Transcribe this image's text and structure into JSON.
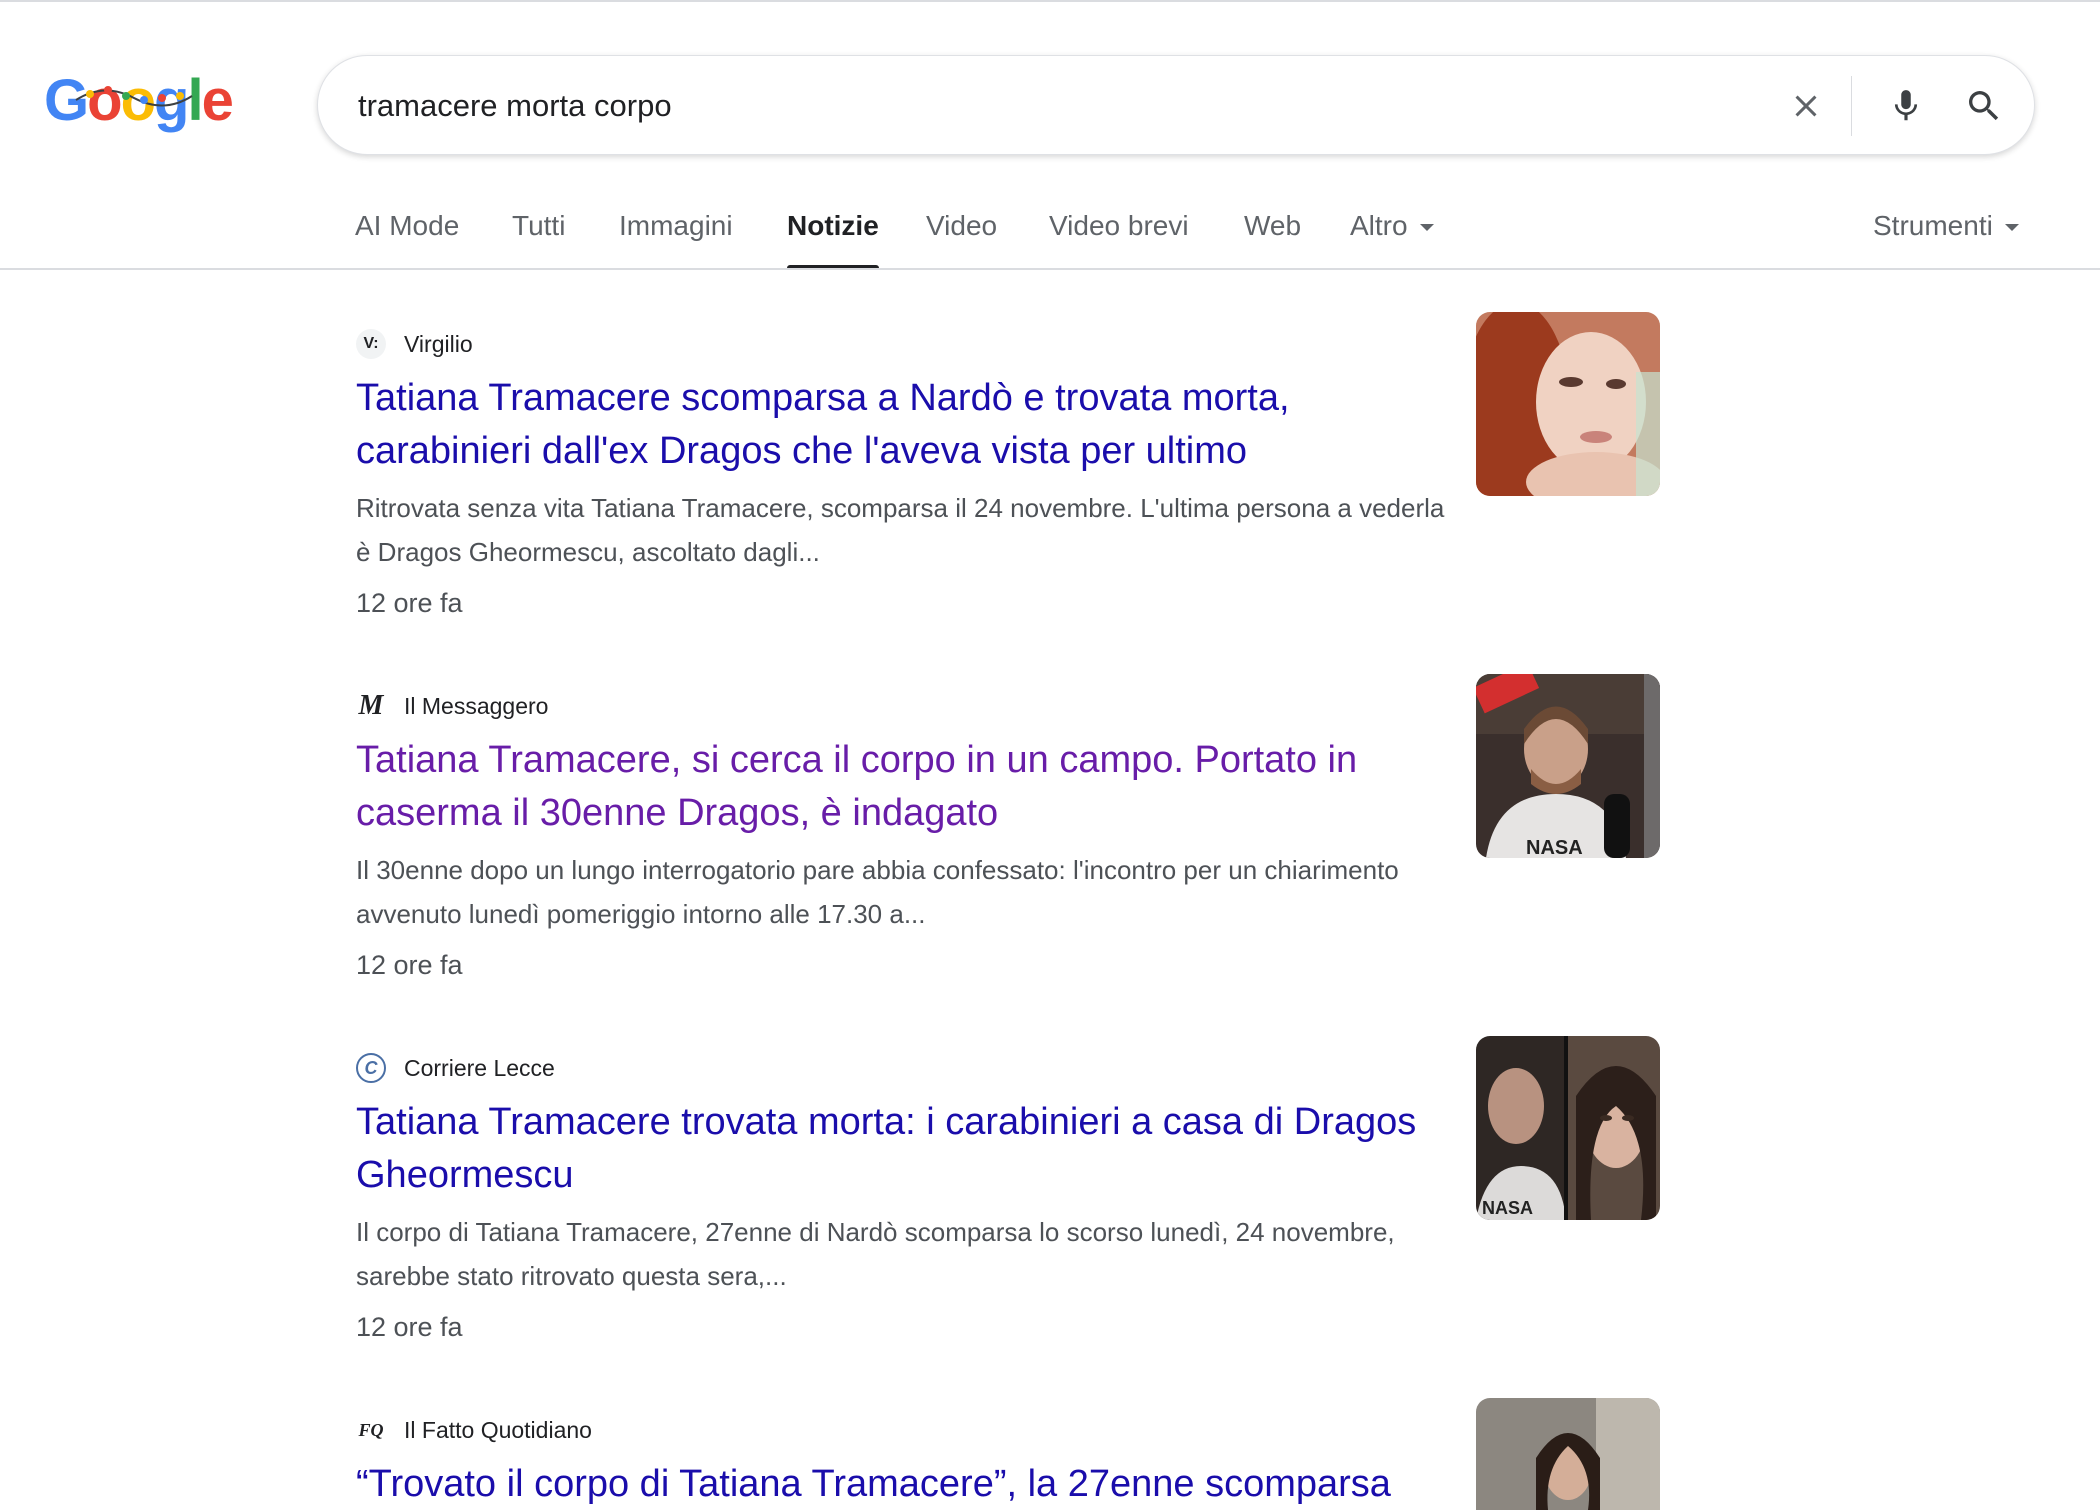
{
  "logo": {
    "letters": [
      "G",
      "o",
      "o",
      "g",
      "l",
      "e"
    ]
  },
  "search": {
    "query": "tramacere morta corpo"
  },
  "search_icons": {
    "clear": "close-icon",
    "voice": "mic-icon",
    "submit": "search-icon"
  },
  "tabs": [
    {
      "label": "AI Mode"
    },
    {
      "label": "Tutti"
    },
    {
      "label": "Immagini"
    },
    {
      "label": "Notizie"
    },
    {
      "label": "Video"
    },
    {
      "label": "Video brevi"
    },
    {
      "label": "Web"
    },
    {
      "label": "Altro"
    }
  ],
  "tools": {
    "label": "Strumenti"
  },
  "active_tab": "Notizie",
  "colors": {
    "link": "#1a0dab",
    "visited": "#681da8",
    "snippet": "#4d5156"
  },
  "results": [
    {
      "source": "Virgilio",
      "favicon_text": "V:",
      "title": "Tatiana Tramacere scomparsa a Nardò e trovata morta, carabinieri dall'ex Dragos che l'aveva vista per ultimo",
      "snippet": "Ritrovata senza vita Tatiana Tramacere, scomparsa il 24 novembre. L'ultima persona a vederla è Dragos Gheormescu, ascoltato dagli...",
      "time": "12 ore fa"
    },
    {
      "source": "Il Messaggero",
      "favicon_text": "M",
      "title": "Tatiana Tramacere, si cerca il corpo in un campo. Portato in caserma il 30enne Dragos, è indagato",
      "snippet": "Il 30enne dopo un lungo interrogatorio pare abbia confessato: l'incontro per un chiarimento avvenuto lunedì pomeriggio intorno alle 17.30 a...",
      "time": "12 ore fa"
    },
    {
      "source": "Corriere Lecce",
      "favicon_text": "C",
      "title": "Tatiana Tramacere trovata morta: i carabinieri a casa di Dragos Gheormescu",
      "snippet": "Il corpo di Tatiana Tramacere, 27enne di Nardò scomparsa lo scorso lunedì, 24 novembre, sarebbe stato ritrovato questa sera,...",
      "time": "12 ore fa"
    },
    {
      "source": "Il Fatto Quotidiano",
      "favicon_text": "FQ",
      "title": "“Trovato il corpo di Tatiana Tramacere”, la 27enne scomparsa",
      "snippet": "",
      "time": ""
    }
  ]
}
